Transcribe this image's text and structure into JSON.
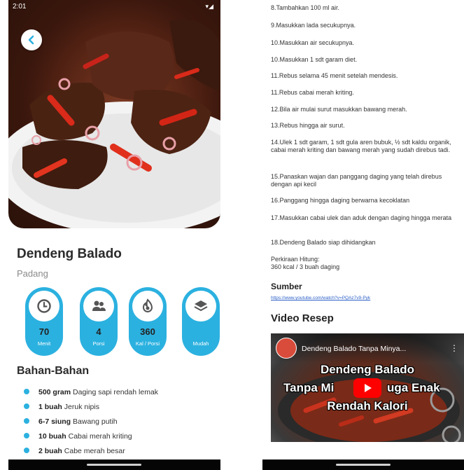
{
  "status_bar": {
    "time": "2:01",
    "icons": "▾◢"
  },
  "recipe": {
    "title": "Dendeng Balado",
    "region": "Padang",
    "stats": [
      {
        "icon": "clock-icon",
        "value": "70",
        "label": "Menit"
      },
      {
        "icon": "people-icon",
        "value": "4",
        "label": "Porsi"
      },
      {
        "icon": "flame-icon",
        "value": "360",
        "label": "Kal / Porsi"
      },
      {
        "icon": "layers-icon",
        "value": "",
        "label": "Mudah"
      }
    ]
  },
  "ingredients": {
    "title": "Bahan-Bahan",
    "items": [
      {
        "qty": "500 gram",
        "name": "Daging sapi rendah lemak"
      },
      {
        "qty": "1 buah",
        "name": "Jeruk nipis"
      },
      {
        "qty": "6-7 siung",
        "name": "Bawang putih"
      },
      {
        "qty": "10 buah",
        "name": "Cabai merah kriting"
      },
      {
        "qty": "2 buah",
        "name": "Cabe merah besar"
      }
    ]
  },
  "steps": [
    "8.Tambahkan 100 ml air.",
    "9.Masukkan lada secukupnya.",
    "10.Masukkan air secukupnya.",
    "10.Masukkan 1 sdt garam diet.",
    "11.Rebus selama 45 menit setelah mendesis.",
    "11.Rebus cabai merah kriting.",
    "12.Bila air mulai surut masukkan bawang merah.",
    "13.Rebus hingga air surut.",
    "14.Ulek 1 sdt garam, 1 sdt gula aren bubuk, ½ sdt kaldu organik, cabai merah kriting dan bawang merah yang sudah direbus tadi.",
    "15.Panaskan wajan dan panggang daging yang telah direbus dengan api kecil",
    "16.Panggang hingga daging berwarna kecoklatan",
    "17.Masukkan cabai ulek dan aduk dengan daging hingga merata",
    "18.Dendeng Balado siap dihidangkan"
  ],
  "estimate": {
    "line1": "Perkiraan Hitung:",
    "line2": "360 kcal / 3 buah daging"
  },
  "source": {
    "title": "Sumber",
    "url": "https://www.youtube.com/watch?v=PQAz7v9-Pyk"
  },
  "video": {
    "section_title": "Video Resep",
    "header": "Dendeng Balado Tanpa Minya...",
    "overlay_line1": "Dendeng Balado",
    "overlay_line2_a": "Tanpa Mi",
    "overlay_line2_b": "uga Enak",
    "overlay_line3": "Rendah Kalori"
  },
  "colors": {
    "accent": "#2bb1e0",
    "play": "#ff0000",
    "link": "#2b5fc7"
  }
}
